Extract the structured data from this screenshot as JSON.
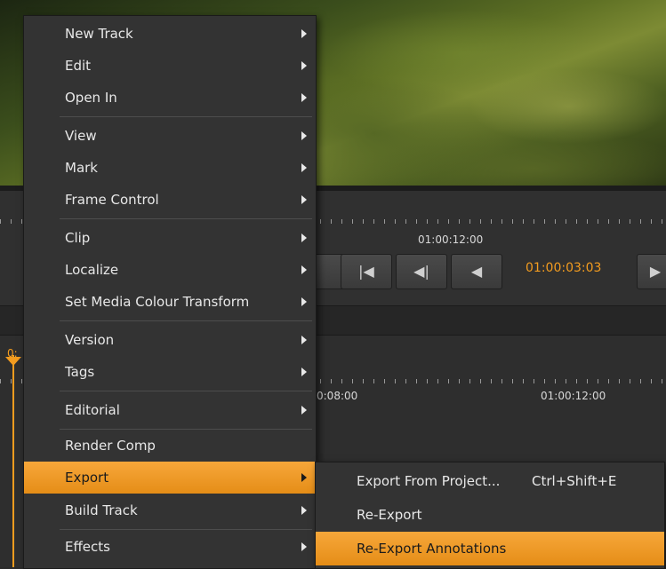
{
  "viewer": {
    "upper_ruler_timecode": "01:00:12:00",
    "current_timecode": "01:00:03:03",
    "lower_ruler_timecodes": [
      "0:08:00",
      "01:00:12:00"
    ],
    "playhead_timecode_fragment": "0:"
  },
  "transport": {
    "buttons": [
      {
        "icon": "prev-clip-icon",
        "glyph": "|◀"
      },
      {
        "icon": "prev-frame-icon",
        "glyph": "◀|"
      },
      {
        "icon": "play-backward-icon",
        "glyph": "◀"
      }
    ],
    "partial_button_glyph": "▶"
  },
  "menu": {
    "items": [
      {
        "label": "New Track",
        "submenu": true
      },
      {
        "label": "Edit",
        "submenu": true
      },
      {
        "label": "Open In",
        "submenu": true
      },
      {
        "label": "View",
        "submenu": true
      },
      {
        "label": "Mark",
        "submenu": true
      },
      {
        "label": "Frame Control",
        "submenu": true
      },
      {
        "label": "Clip",
        "submenu": true
      },
      {
        "label": "Localize",
        "submenu": true
      },
      {
        "label": "Set Media Colour Transform",
        "submenu": true
      },
      {
        "label": "Version",
        "submenu": true
      },
      {
        "label": "Tags",
        "submenu": true
      },
      {
        "label": "Editorial",
        "submenu": true
      },
      {
        "label": "Render Comp",
        "submenu": false
      },
      {
        "label": "Export",
        "submenu": true,
        "highlighted": true
      },
      {
        "label": "Build Track",
        "submenu": true
      },
      {
        "label": "Effects",
        "submenu": true
      }
    ],
    "highlight_color": "#f39c1f"
  },
  "export_submenu": {
    "items": [
      {
        "label": "Export From Project...",
        "shortcut": "Ctrl+Shift+E"
      },
      {
        "label": "Re-Export",
        "shortcut": ""
      },
      {
        "label": "Re-Export Annotations",
        "shortcut": "",
        "highlighted": true
      }
    ]
  }
}
